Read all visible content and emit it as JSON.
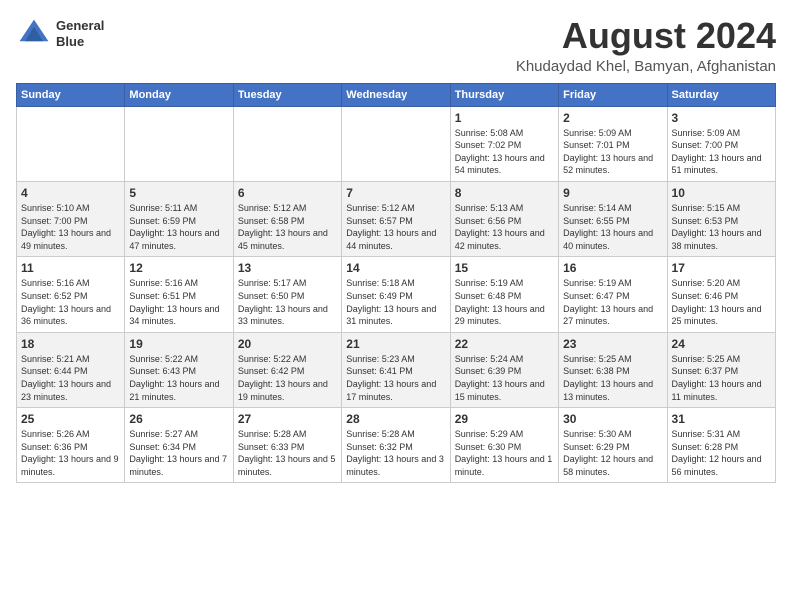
{
  "logo": {
    "line1": "General",
    "line2": "Blue"
  },
  "title": "August 2024",
  "subtitle": "Khudaydad Khel, Bamyan, Afghanistan",
  "days_of_week": [
    "Sunday",
    "Monday",
    "Tuesday",
    "Wednesday",
    "Thursday",
    "Friday",
    "Saturday"
  ],
  "weeks": [
    [
      {
        "day": "",
        "info": ""
      },
      {
        "day": "",
        "info": ""
      },
      {
        "day": "",
        "info": ""
      },
      {
        "day": "",
        "info": ""
      },
      {
        "day": "1",
        "info": "Sunrise: 5:08 AM\nSunset: 7:02 PM\nDaylight: 13 hours\nand 54 minutes."
      },
      {
        "day": "2",
        "info": "Sunrise: 5:09 AM\nSunset: 7:01 PM\nDaylight: 13 hours\nand 52 minutes."
      },
      {
        "day": "3",
        "info": "Sunrise: 5:09 AM\nSunset: 7:00 PM\nDaylight: 13 hours\nand 51 minutes."
      }
    ],
    [
      {
        "day": "4",
        "info": "Sunrise: 5:10 AM\nSunset: 7:00 PM\nDaylight: 13 hours\nand 49 minutes."
      },
      {
        "day": "5",
        "info": "Sunrise: 5:11 AM\nSunset: 6:59 PM\nDaylight: 13 hours\nand 47 minutes."
      },
      {
        "day": "6",
        "info": "Sunrise: 5:12 AM\nSunset: 6:58 PM\nDaylight: 13 hours\nand 45 minutes."
      },
      {
        "day": "7",
        "info": "Sunrise: 5:12 AM\nSunset: 6:57 PM\nDaylight: 13 hours\nand 44 minutes."
      },
      {
        "day": "8",
        "info": "Sunrise: 5:13 AM\nSunset: 6:56 PM\nDaylight: 13 hours\nand 42 minutes."
      },
      {
        "day": "9",
        "info": "Sunrise: 5:14 AM\nSunset: 6:55 PM\nDaylight: 13 hours\nand 40 minutes."
      },
      {
        "day": "10",
        "info": "Sunrise: 5:15 AM\nSunset: 6:53 PM\nDaylight: 13 hours\nand 38 minutes."
      }
    ],
    [
      {
        "day": "11",
        "info": "Sunrise: 5:16 AM\nSunset: 6:52 PM\nDaylight: 13 hours\nand 36 minutes."
      },
      {
        "day": "12",
        "info": "Sunrise: 5:16 AM\nSunset: 6:51 PM\nDaylight: 13 hours\nand 34 minutes."
      },
      {
        "day": "13",
        "info": "Sunrise: 5:17 AM\nSunset: 6:50 PM\nDaylight: 13 hours\nand 33 minutes."
      },
      {
        "day": "14",
        "info": "Sunrise: 5:18 AM\nSunset: 6:49 PM\nDaylight: 13 hours\nand 31 minutes."
      },
      {
        "day": "15",
        "info": "Sunrise: 5:19 AM\nSunset: 6:48 PM\nDaylight: 13 hours\nand 29 minutes."
      },
      {
        "day": "16",
        "info": "Sunrise: 5:19 AM\nSunset: 6:47 PM\nDaylight: 13 hours\nand 27 minutes."
      },
      {
        "day": "17",
        "info": "Sunrise: 5:20 AM\nSunset: 6:46 PM\nDaylight: 13 hours\nand 25 minutes."
      }
    ],
    [
      {
        "day": "18",
        "info": "Sunrise: 5:21 AM\nSunset: 6:44 PM\nDaylight: 13 hours\nand 23 minutes."
      },
      {
        "day": "19",
        "info": "Sunrise: 5:22 AM\nSunset: 6:43 PM\nDaylight: 13 hours\nand 21 minutes."
      },
      {
        "day": "20",
        "info": "Sunrise: 5:22 AM\nSunset: 6:42 PM\nDaylight: 13 hours\nand 19 minutes."
      },
      {
        "day": "21",
        "info": "Sunrise: 5:23 AM\nSunset: 6:41 PM\nDaylight: 13 hours\nand 17 minutes."
      },
      {
        "day": "22",
        "info": "Sunrise: 5:24 AM\nSunset: 6:39 PM\nDaylight: 13 hours\nand 15 minutes."
      },
      {
        "day": "23",
        "info": "Sunrise: 5:25 AM\nSunset: 6:38 PM\nDaylight: 13 hours\nand 13 minutes."
      },
      {
        "day": "24",
        "info": "Sunrise: 5:25 AM\nSunset: 6:37 PM\nDaylight: 13 hours\nand 11 minutes."
      }
    ],
    [
      {
        "day": "25",
        "info": "Sunrise: 5:26 AM\nSunset: 6:36 PM\nDaylight: 13 hours\nand 9 minutes."
      },
      {
        "day": "26",
        "info": "Sunrise: 5:27 AM\nSunset: 6:34 PM\nDaylight: 13 hours\nand 7 minutes."
      },
      {
        "day": "27",
        "info": "Sunrise: 5:28 AM\nSunset: 6:33 PM\nDaylight: 13 hours\nand 5 minutes."
      },
      {
        "day": "28",
        "info": "Sunrise: 5:28 AM\nSunset: 6:32 PM\nDaylight: 13 hours\nand 3 minutes."
      },
      {
        "day": "29",
        "info": "Sunrise: 5:29 AM\nSunset: 6:30 PM\nDaylight: 13 hours\nand 1 minute."
      },
      {
        "day": "30",
        "info": "Sunrise: 5:30 AM\nSunset: 6:29 PM\nDaylight: 12 hours\nand 58 minutes."
      },
      {
        "day": "31",
        "info": "Sunrise: 5:31 AM\nSunset: 6:28 PM\nDaylight: 12 hours\nand 56 minutes."
      }
    ]
  ]
}
